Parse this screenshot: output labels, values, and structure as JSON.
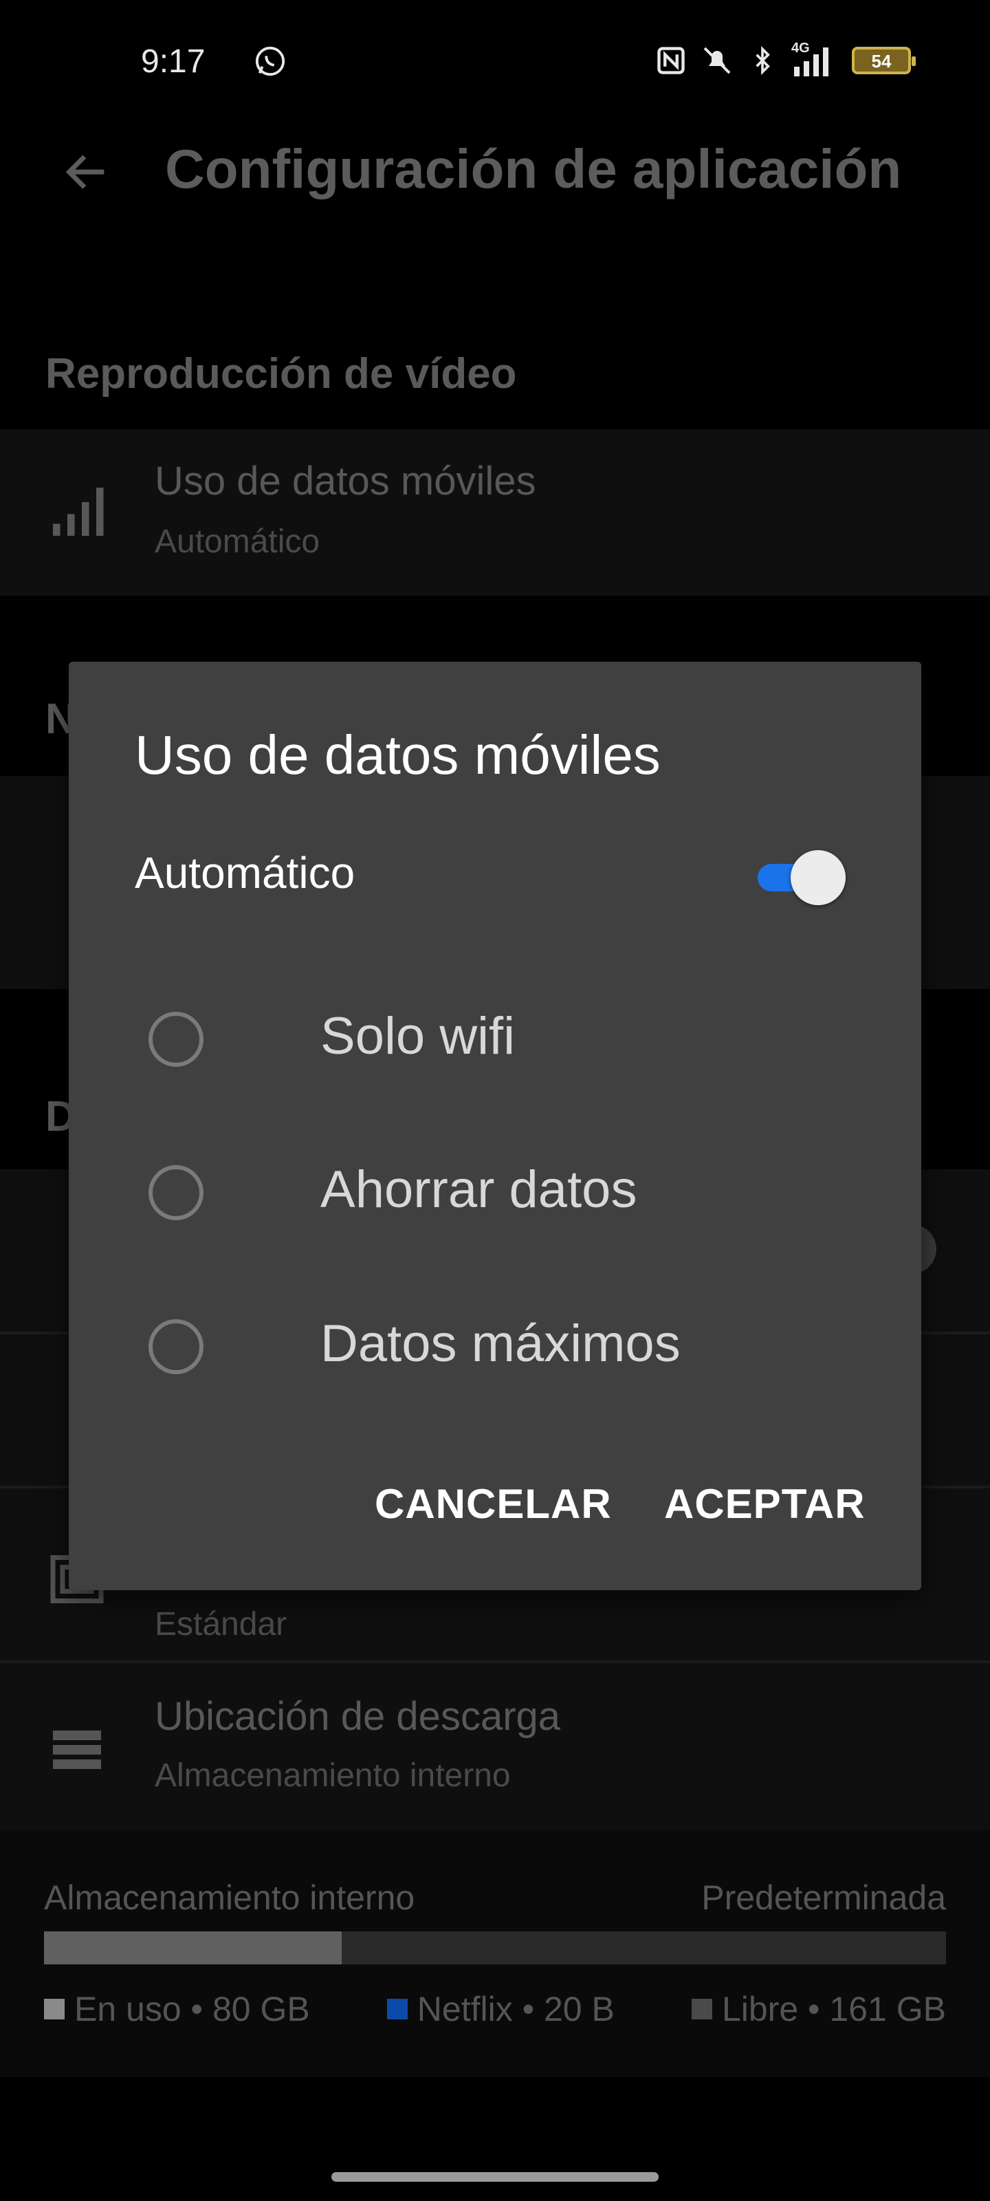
{
  "status_bar": {
    "time": "9:17",
    "network": "4G",
    "battery": "54"
  },
  "header": {
    "title": "Configuración de aplicación",
    "back_icon": "arrow-left-icon"
  },
  "sections": {
    "video": "Reproducción de vídeo",
    "notifications_partial": "N",
    "downloads_partial": "D"
  },
  "settings": {
    "mobile_data": {
      "title": "Uso de datos móviles",
      "subtitle": "Automático",
      "icon": "signal-bars-icon"
    },
    "video_quality": {
      "subtitle": "Estándar",
      "icon": "video-quality-icon"
    },
    "download_location": {
      "title": "Ubicación de descarga",
      "subtitle": "Almacenamiento interno",
      "icon": "storage-list-icon"
    }
  },
  "storage": {
    "label": "Almacenamiento interno",
    "default_label": "Predeterminada",
    "used_fraction": 0.33,
    "netflix_fraction": 0.0,
    "legend": [
      {
        "label": "En uso • 80 GB",
        "color": "#8a8a8a"
      },
      {
        "label": "Netflix • 20 B",
        "color": "#0b4aa8"
      },
      {
        "label": "Libre • 161 GB",
        "color": "#4a4a4a"
      }
    ]
  },
  "dialog": {
    "title": "Uso de datos móviles",
    "auto_label": "Automático",
    "auto_enabled": true,
    "options": [
      {
        "label": "Solo wifi",
        "selected": false
      },
      {
        "label": "Ahorrar datos",
        "selected": false
      },
      {
        "label": "Datos máximos",
        "selected": false
      }
    ],
    "cancel": "CANCELAR",
    "accept": "ACEPTAR"
  },
  "colors": {
    "accent": "#1a73e8",
    "dialog_bg": "#404040",
    "page_bg": "#000000"
  }
}
